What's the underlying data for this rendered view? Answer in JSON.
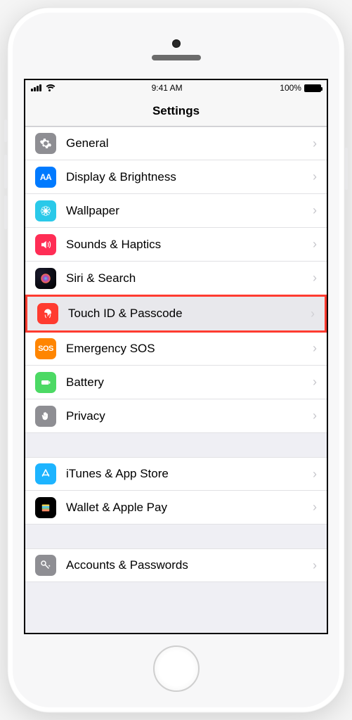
{
  "status": {
    "time": "9:41 AM",
    "battery_pct": "100%"
  },
  "header": {
    "title": "Settings"
  },
  "groups": [
    {
      "items": [
        {
          "id": "general",
          "label": "General",
          "color": "c-general",
          "icon": "gear"
        },
        {
          "id": "display",
          "label": "Display & Brightness",
          "color": "c-display",
          "icon": "aa"
        },
        {
          "id": "wallpaper",
          "label": "Wallpaper",
          "color": "c-wallpaper",
          "icon": "flower"
        },
        {
          "id": "sounds",
          "label": "Sounds & Haptics",
          "color": "c-sounds",
          "icon": "speaker"
        },
        {
          "id": "siri",
          "label": "Siri & Search",
          "color": "c-siri",
          "icon": "siri"
        },
        {
          "id": "touchid",
          "label": "Touch ID & Passcode",
          "color": "c-touchid",
          "icon": "fingerprint",
          "highlight": true
        },
        {
          "id": "sos",
          "label": "Emergency SOS",
          "color": "c-sos",
          "icon": "sos"
        },
        {
          "id": "battery",
          "label": "Battery",
          "color": "c-battery",
          "icon": "batt"
        },
        {
          "id": "privacy",
          "label": "Privacy",
          "color": "c-privacy",
          "icon": "hand"
        }
      ]
    },
    {
      "items": [
        {
          "id": "itunes",
          "label": "iTunes & App Store",
          "color": "c-itunes",
          "icon": "appstore"
        },
        {
          "id": "wallet",
          "label": "Wallet & Apple Pay",
          "color": "c-wallet",
          "icon": "wallet"
        }
      ]
    },
    {
      "items": [
        {
          "id": "accounts",
          "label": "Accounts & Passwords",
          "color": "c-accounts",
          "icon": "key"
        }
      ]
    }
  ]
}
